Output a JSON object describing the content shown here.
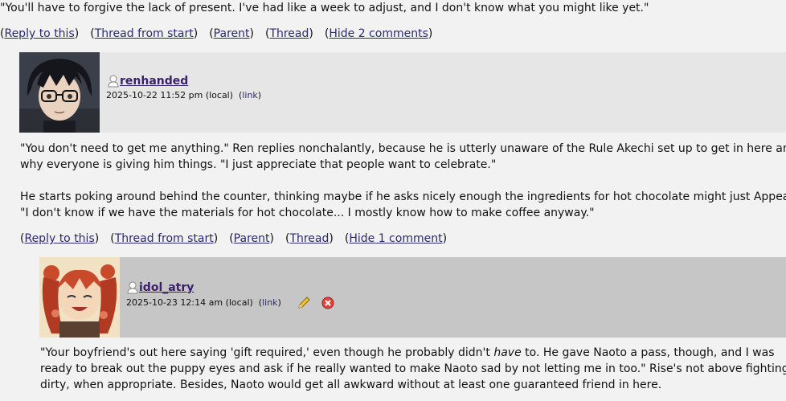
{
  "top_comment": {
    "text": "\"You'll have to forgive the lack of present. I've had like a week to adjust, and I don't know what you might like yet.\"",
    "links": {
      "reply": "Reply to this",
      "thread_start": "Thread from start",
      "parent": "Parent",
      "thread": "Thread",
      "hide": "Hide 2 comments"
    }
  },
  "comment1": {
    "username": "renhanded",
    "timestamp": "2025-10-22 11:52 pm (local)",
    "link_label": "link",
    "paragraphs": [
      {
        "line1": "\"You don't need to get me anything.\" Ren replies nonchalantly, because he is utterly unaware of the Rule Akechi set up to get in here and",
        "line2": "why everyone is giving him things. \"I just appreciate that people want to celebrate.\""
      },
      {
        "line1": "He starts poking around behind the counter, thinking maybe if he asks nicely enough the ingredients for hot chocolate might just Appear.",
        "line2": "\"I don't know if we have the materials for hot chocolate... I mostly know how to make coffee anyway.\""
      }
    ],
    "links": {
      "reply": "Reply to this",
      "thread_start": "Thread from start",
      "parent": "Parent",
      "thread": "Thread",
      "hide": "Hide 1 comment"
    }
  },
  "comment2": {
    "username": "idol_atry",
    "timestamp": "2025-10-23 12:14 am (local)",
    "link_label": "link",
    "line1_pre": "\"Your boyfriend's out here saying 'gift required,' even though he probably didn't ",
    "line1_em": "have",
    "line1_post": " to. He gave Naoto a pass, though, and I was",
    "line2": "ready to break out the puppy eyes and ask if he really wanted to make Naoto sad by not letting me in too.\" Rise's not above fighting",
    "line3": "dirty, when appropriate. Besides, Naoto would get all awkward without at least one guaranteed friend in here."
  },
  "colors": {
    "background": "#f2f2f2",
    "header1": "#e6e6e6",
    "header2": "#c6c6c6",
    "link": "#2a2a6e",
    "username": "#3a1f6b"
  },
  "icons": [
    "user-icon",
    "edit-pencil-icon",
    "delete-icon"
  ]
}
